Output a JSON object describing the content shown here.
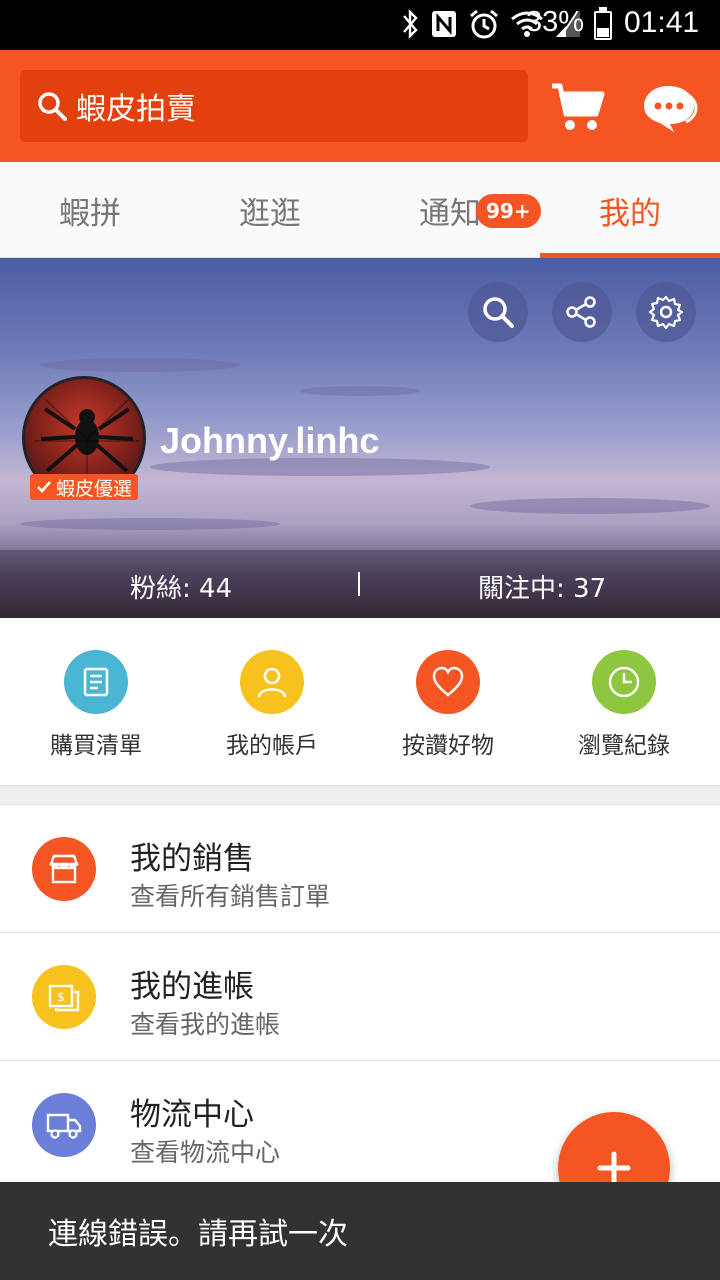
{
  "status_bar": {
    "battery": "33%",
    "time": "01:41",
    "icons": [
      "bluetooth-icon",
      "nfc-icon",
      "alarm-icon",
      "wifi-icon",
      "signal-icon",
      "battery-icon"
    ]
  },
  "header": {
    "search_placeholder": "蝦皮拍賣",
    "icons": [
      "search-icon",
      "cart-icon",
      "chat-icon"
    ]
  },
  "tabs": [
    {
      "label": "蝦拼"
    },
    {
      "label": "逛逛"
    },
    {
      "label": "通知",
      "badge": "99+"
    },
    {
      "label": "我的",
      "active": true
    }
  ],
  "profile": {
    "username": "Johnny.linhc",
    "badge": "蝦皮優選",
    "followers_label": "粉絲: 44",
    "following_label": "關注中: 37",
    "cover_buttons": [
      "search-icon",
      "share-icon",
      "gear-icon"
    ]
  },
  "quick_actions": [
    {
      "label": "購買清單",
      "icon": "list-icon",
      "color": "#4bb6d3"
    },
    {
      "label": "我的帳戶",
      "icon": "user-icon",
      "color": "#f7c21d"
    },
    {
      "label": "按讚好物",
      "icon": "heart-icon",
      "color": "#f55522"
    },
    {
      "label": "瀏覽紀錄",
      "icon": "clock-icon",
      "color": "#8dc63f"
    }
  ],
  "menu": [
    {
      "title": "我的銷售",
      "subtitle": "查看所有銷售訂單",
      "icon": "store-icon",
      "color": "#f55522"
    },
    {
      "title": "我的進帳",
      "subtitle": "查看我的進帳",
      "icon": "money-icon",
      "color": "#f7c21d"
    },
    {
      "title": "物流中心",
      "subtitle": "查看物流中心",
      "icon": "truck-icon",
      "color": "#6c7fd8"
    }
  ],
  "fab": {
    "icon": "plus-icon"
  },
  "snackbar": {
    "message": "連線錯誤。請再試一次"
  },
  "colors": {
    "brand": "#f55522",
    "brand_dark": "#e3400d"
  }
}
